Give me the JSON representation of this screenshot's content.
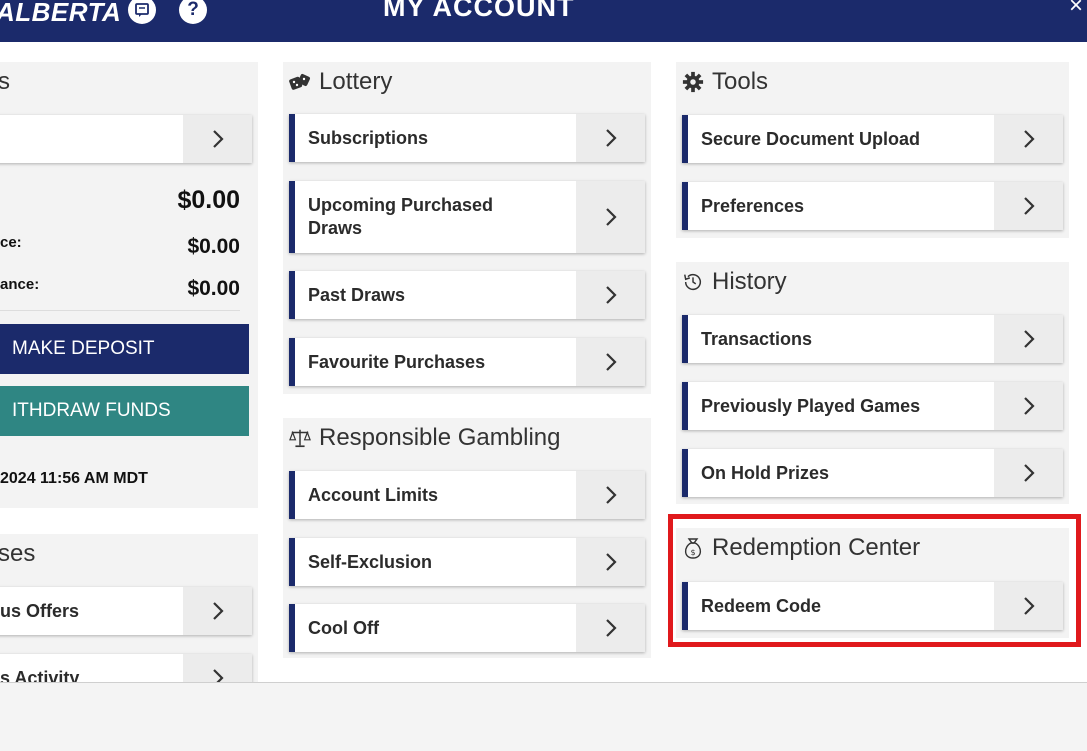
{
  "header": {
    "brand": "ALBERTA",
    "help": "?",
    "title": "MY ACCOUNT",
    "close": "×"
  },
  "account": {
    "title_partial": "s",
    "total": "$0.00",
    "row1_label": "ce:",
    "row1_value": "$0.00",
    "row2_label": "ance:",
    "row2_value": "$0.00",
    "deposit_label": "MAKE DEPOSIT",
    "withdraw_label": "ITHDRAW FUNDS",
    "timestamp": "2024 11:56 AM MDT",
    "colors": {
      "deposit": "#1b2a6b",
      "withdraw": "#2f8683"
    }
  },
  "bonuses": {
    "title_partial": "ses",
    "items": [
      "us Offers",
      "s Activity"
    ]
  },
  "lottery": {
    "title": "Lottery",
    "icon": "dice-icon",
    "items": [
      "Subscriptions",
      "Upcoming Purchased Draws",
      "Past Draws",
      "Favourite Purchases"
    ]
  },
  "responsible": {
    "title": "Responsible Gambling",
    "icon": "scale-icon",
    "items": [
      "Account Limits",
      "Self-Exclusion",
      "Cool Off"
    ]
  },
  "tools": {
    "title": "Tools",
    "icon": "gear-icon",
    "items": [
      "Secure Document Upload",
      "Preferences"
    ]
  },
  "history": {
    "title": "History",
    "icon": "history-icon",
    "items": [
      "Transactions",
      "Previously Played Games",
      "On Hold Prizes"
    ]
  },
  "redemption": {
    "title": "Redemption Center",
    "icon": "money-bag-icon",
    "items": [
      "Redeem Code"
    ]
  },
  "colors": {
    "brand_navy": "#1b2a6b",
    "highlight_red": "#e0191c"
  }
}
